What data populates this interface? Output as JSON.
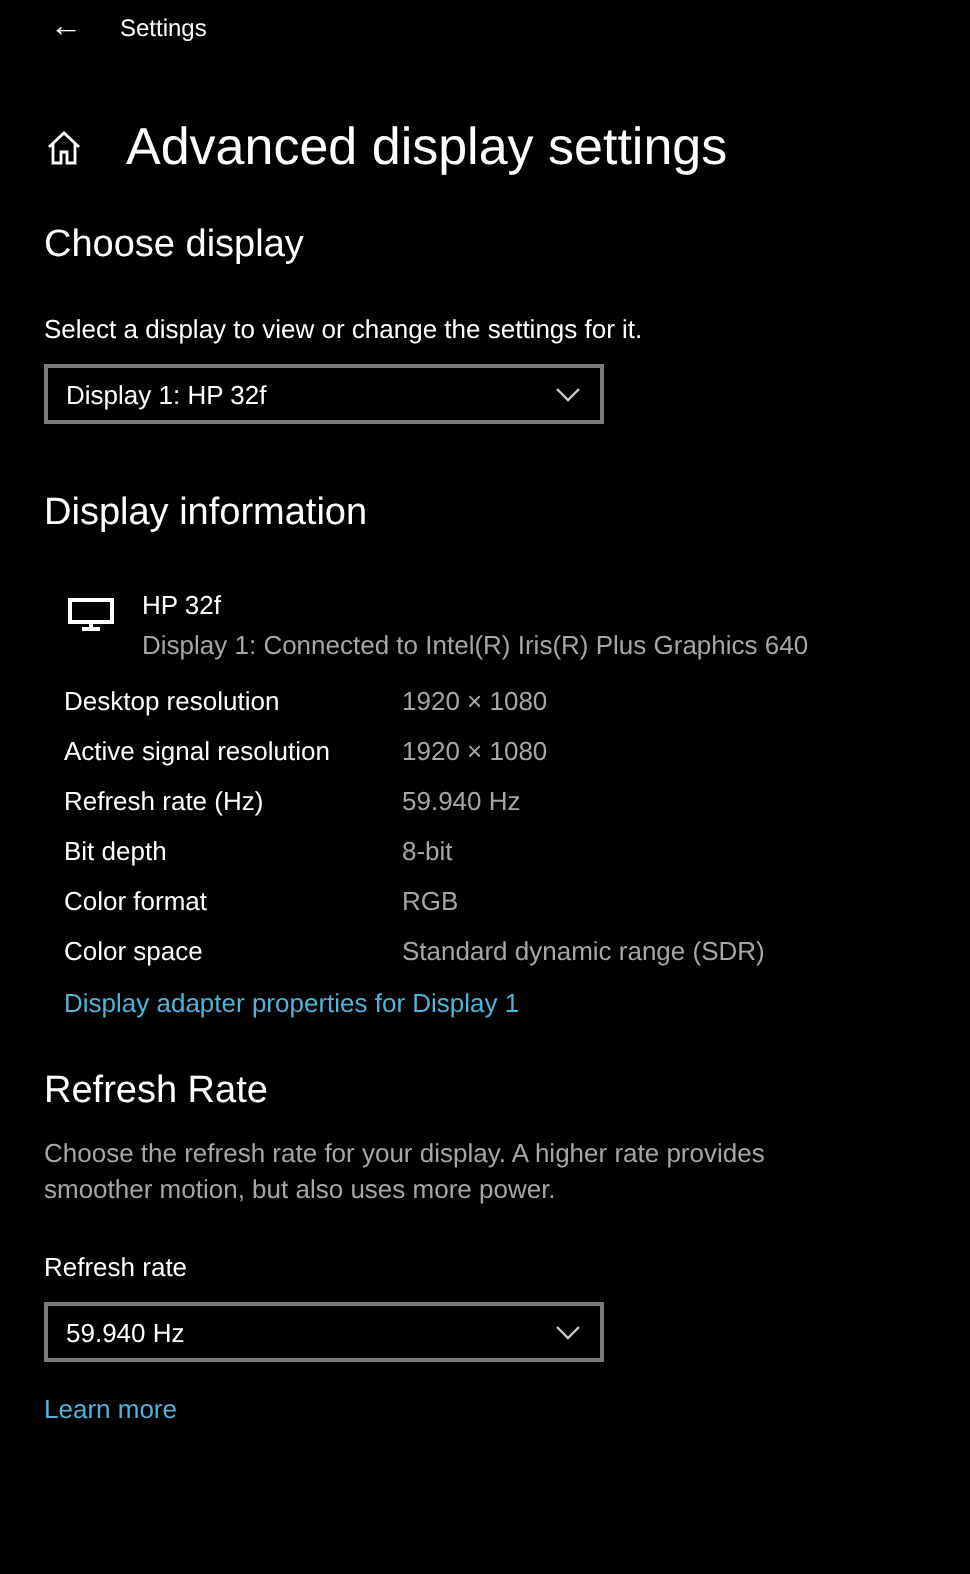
{
  "window": {
    "title": "Settings",
    "back_glyph": "←"
  },
  "page_title": "Advanced display settings",
  "choose_display": {
    "heading": "Choose display",
    "description": "Select a display to view or change the settings for it.",
    "dropdown": {
      "value": "Display 1: HP 32f"
    }
  },
  "display_information": {
    "heading": "Display information",
    "monitor": {
      "name": "HP 32f",
      "connection": "Display 1: Connected to Intel(R) Iris(R) Plus Graphics 640"
    },
    "rows": [
      {
        "label": "Desktop resolution",
        "value": "1920 × 1080"
      },
      {
        "label": "Active signal resolution",
        "value": "1920 × 1080"
      },
      {
        "label": "Refresh rate (Hz)",
        "value": "59.940 Hz"
      },
      {
        "label": "Bit depth",
        "value": "8-bit"
      },
      {
        "label": "Color format",
        "value": "RGB"
      },
      {
        "label": "Color space",
        "value": "Standard dynamic range (SDR)"
      }
    ],
    "link": "Display adapter properties for Display 1"
  },
  "refresh_rate": {
    "heading": "Refresh Rate",
    "description": "Choose the refresh rate for your display. A higher rate provides smoother motion, but also uses more power.",
    "field_label": "Refresh rate",
    "dropdown": {
      "value": "59.940 Hz"
    },
    "link": "Learn more"
  }
}
